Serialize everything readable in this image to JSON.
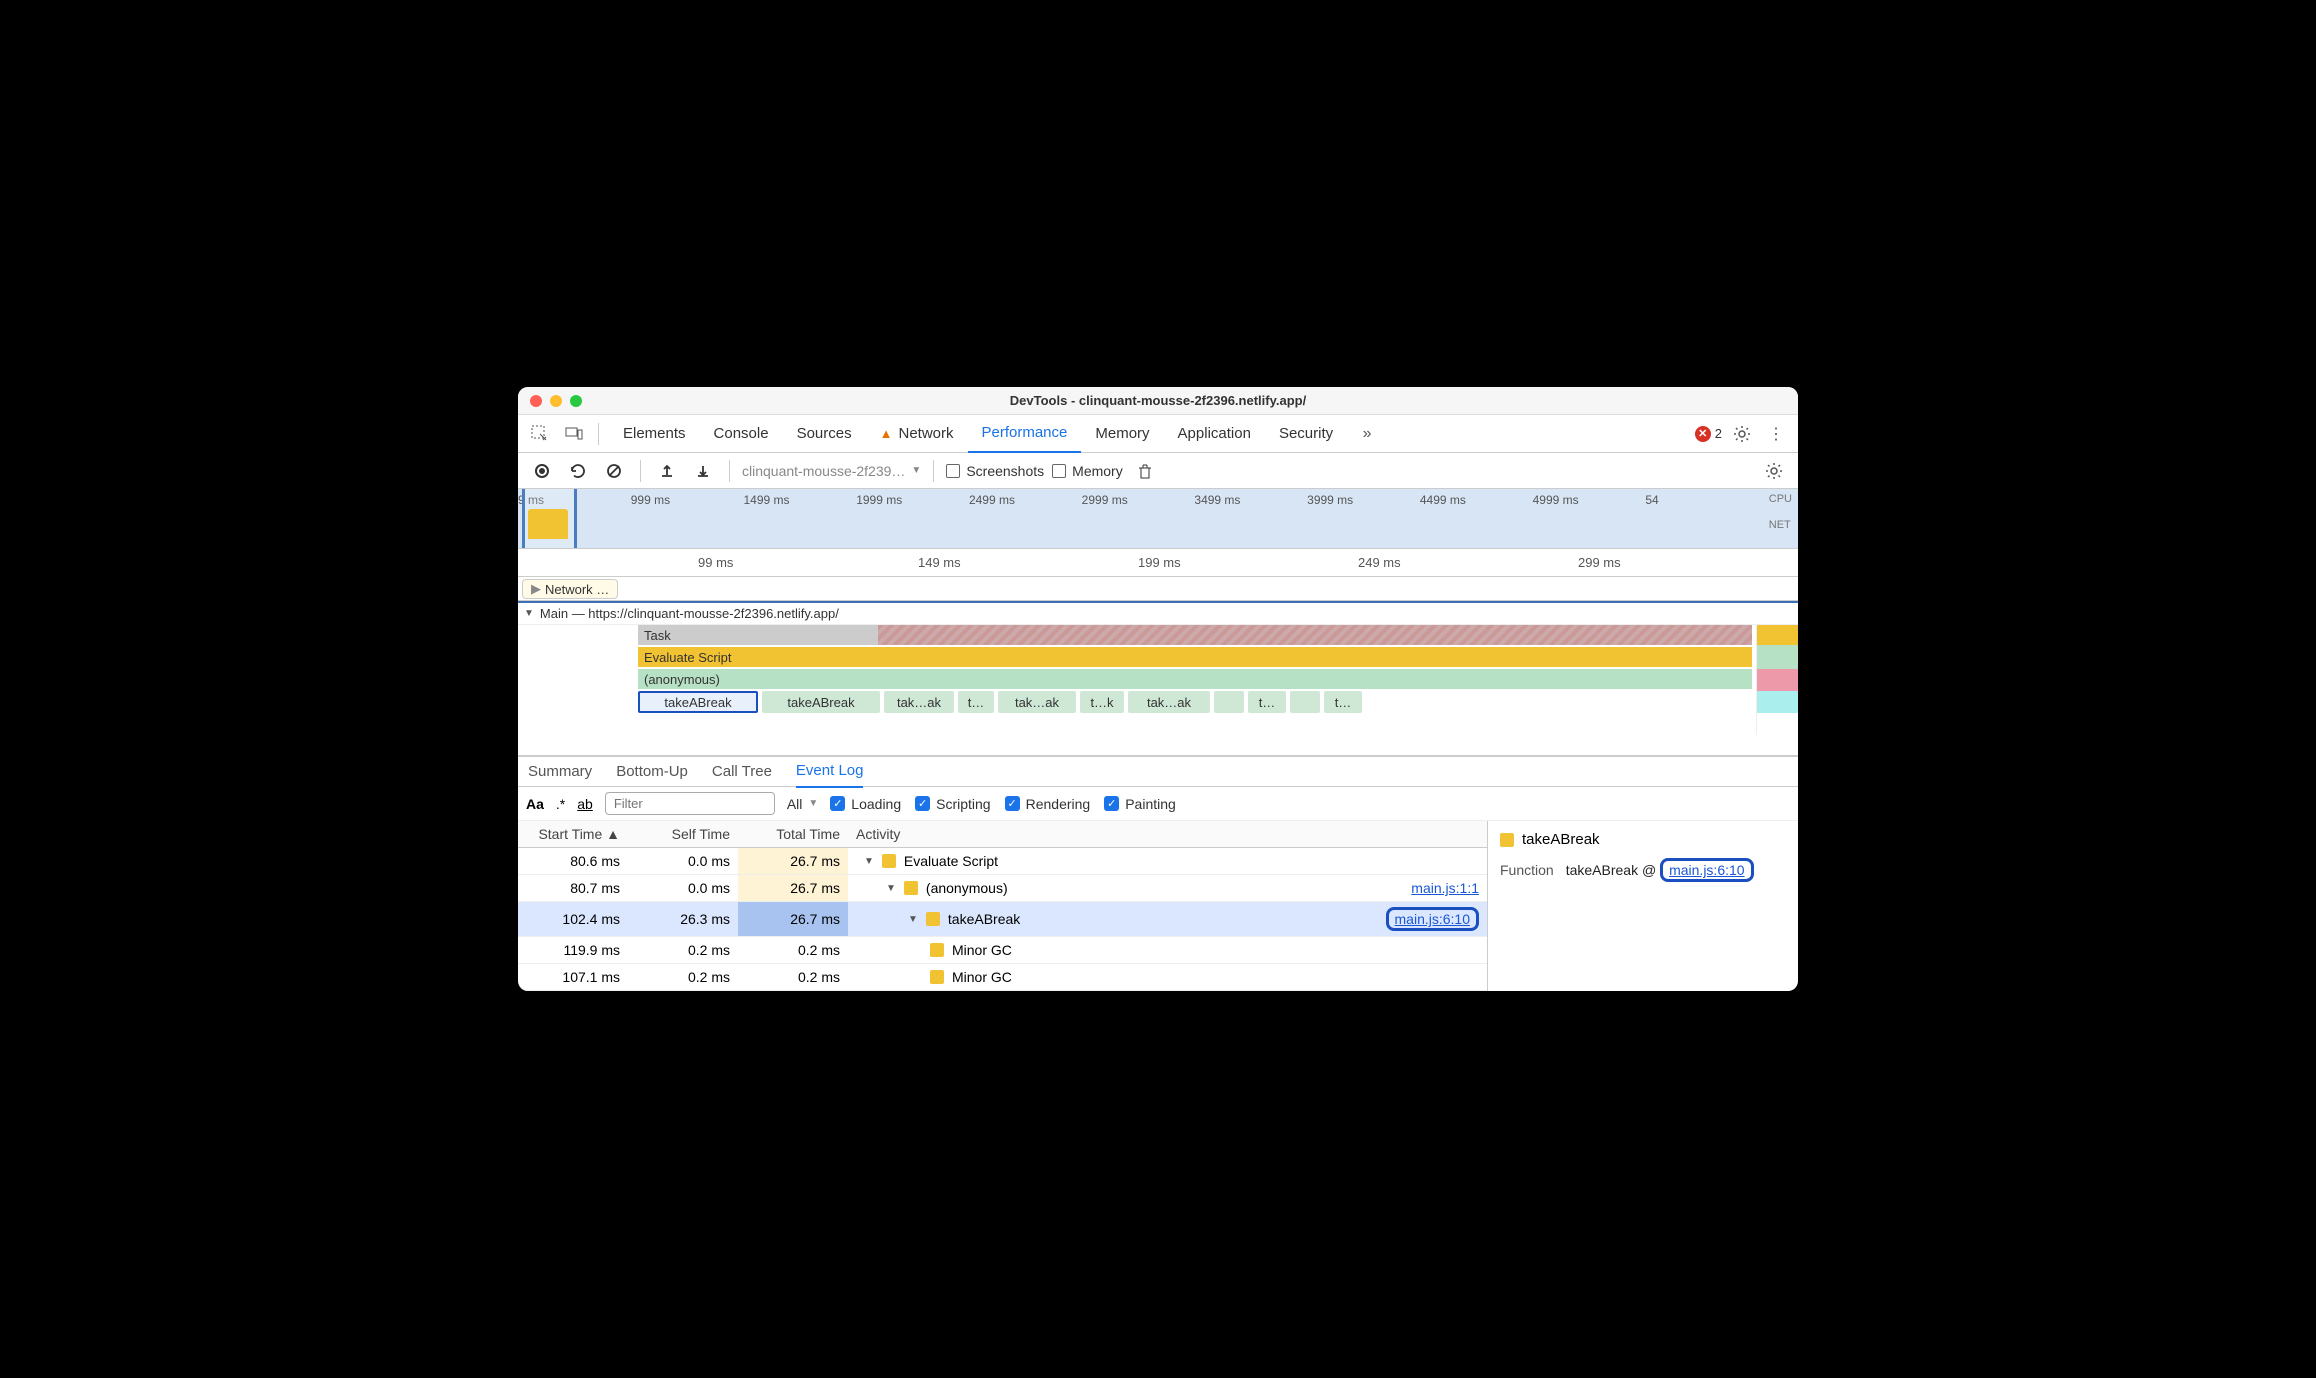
{
  "title": "DevTools - clinquant-mousse-2f2396.netlify.app/",
  "tabs": [
    "Elements",
    "Console",
    "Sources",
    "Network",
    "Performance",
    "Memory",
    "Application",
    "Security"
  ],
  "activeTab": "Performance",
  "errorCount": "2",
  "toolbar": {
    "recording": "clinquant-mousse-2f239…",
    "screenshots": "Screenshots",
    "memory": "Memory"
  },
  "overviewTicks": [
    "9 ms",
    "999 ms",
    "1499 ms",
    "1999 ms",
    "2499 ms",
    "2999 ms",
    "3499 ms",
    "3999 ms",
    "4499 ms",
    "4999 ms",
    "54"
  ],
  "overviewRight": [
    "CPU",
    "NET"
  ],
  "rulerTicks": [
    {
      "label": "99 ms",
      "pos": 180
    },
    {
      "label": "149 ms",
      "pos": 400
    },
    {
      "label": "199 ms",
      "pos": 620
    },
    {
      "label": "249 ms",
      "pos": 840
    },
    {
      "label": "299 ms",
      "pos": 1060
    }
  ],
  "networkLabel": "Network …",
  "mainLabel": "Main — https://clinquant-mousse-2f2396.netlify.app/",
  "flame": {
    "task": "Task",
    "eval": "Evaluate Script",
    "anon": "(anonymous)",
    "calls": [
      "takeABreak",
      "takeABreak",
      "tak…ak",
      "t…",
      "tak…ak",
      "t…k",
      "tak…ak",
      "",
      "t…",
      "",
      "t…"
    ]
  },
  "detailTabs": [
    "Summary",
    "Bottom-Up",
    "Call Tree",
    "Event Log"
  ],
  "activeDetailTab": "Event Log",
  "filter": {
    "placeholder": "Filter",
    "all": "All",
    "checks": [
      "Loading",
      "Scripting",
      "Rendering",
      "Painting"
    ]
  },
  "columns": [
    "Start Time",
    "Self Time",
    "Total Time",
    "Activity"
  ],
  "rows": [
    {
      "start": "80.6 ms",
      "self": "0.0 ms",
      "total": "26.7 ms",
      "indent": 0,
      "open": true,
      "name": "Evaluate Script",
      "link": "",
      "warm": true
    },
    {
      "start": "80.7 ms",
      "self": "0.0 ms",
      "total": "26.7 ms",
      "indent": 1,
      "open": true,
      "name": "(anonymous)",
      "link": "main.js:1:1",
      "warm": true
    },
    {
      "start": "102.4 ms",
      "self": "26.3 ms",
      "total": "26.7 ms",
      "indent": 2,
      "open": true,
      "name": "takeABreak",
      "link": "main.js:6:10",
      "sel": true,
      "ring": true
    },
    {
      "start": "119.9 ms",
      "self": "0.2 ms",
      "total": "0.2 ms",
      "indent": 3,
      "name": "Minor GC",
      "link": ""
    },
    {
      "start": "107.1 ms",
      "self": "0.2 ms",
      "total": "0.2 ms",
      "indent": 3,
      "name": "Minor GC",
      "link": ""
    }
  ],
  "side": {
    "title": "takeABreak",
    "label": "Function",
    "fn": "takeABreak @",
    "link": "main.js:6:10"
  }
}
